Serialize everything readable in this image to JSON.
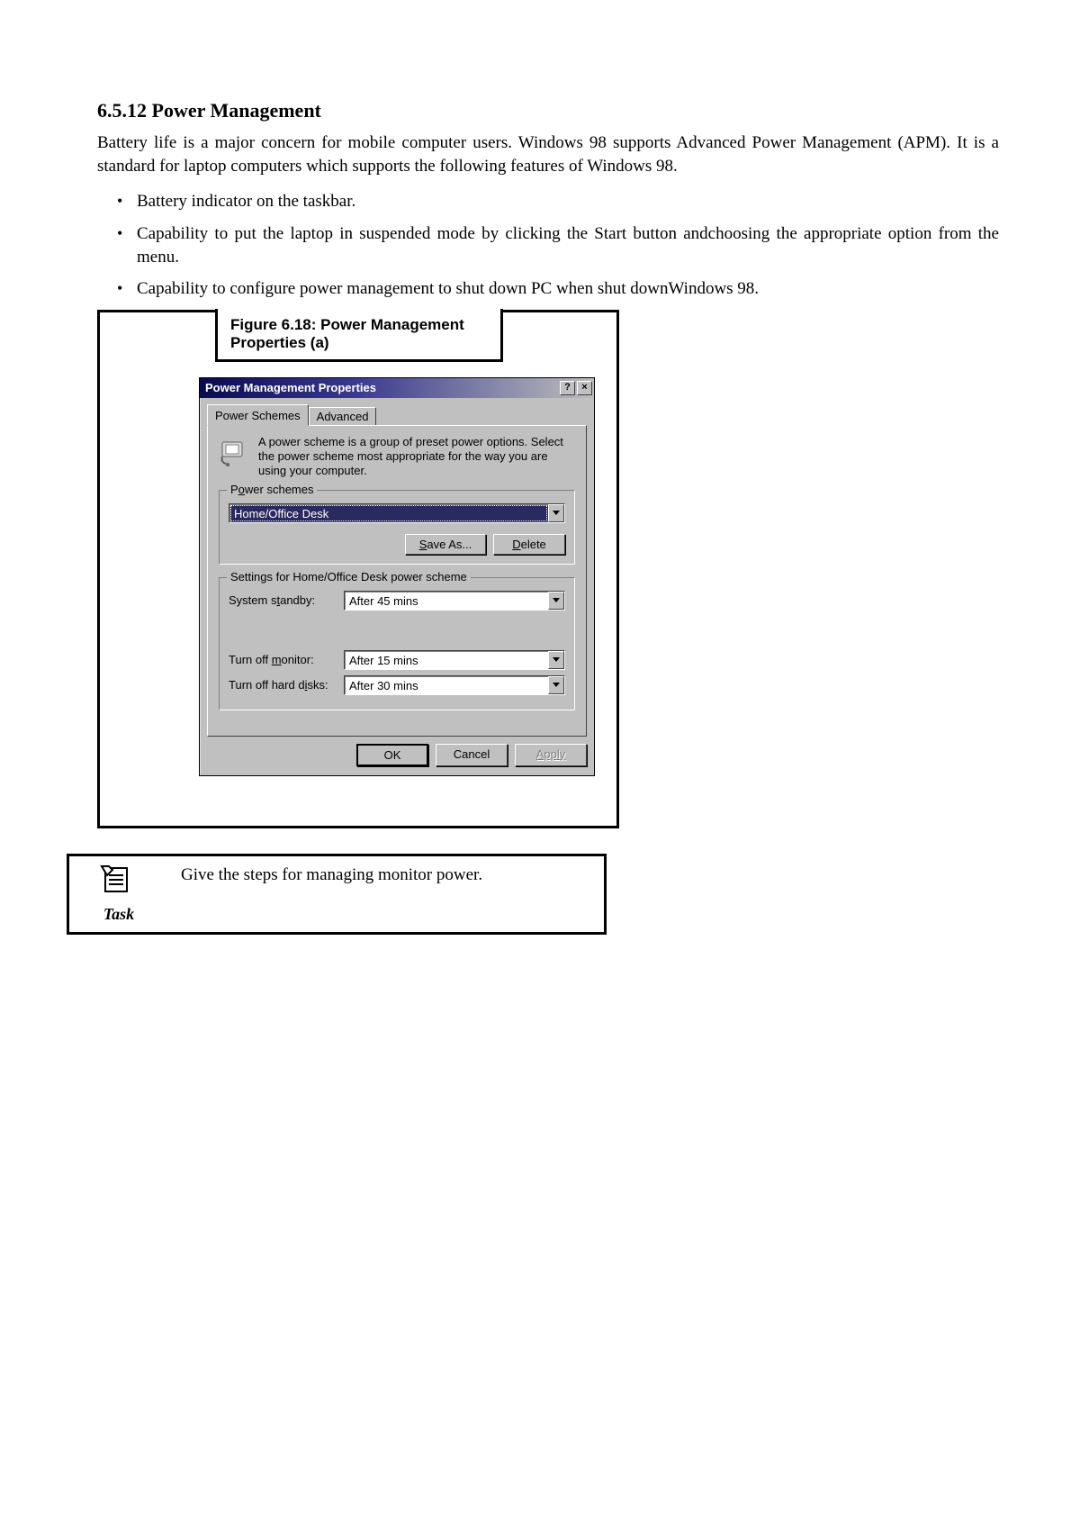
{
  "heading": "6.5.12 Power Management",
  "intro_para": "Battery life is a major concern for mobile computer users. Windows 98 supports Advanced Power Management (APM). It is a standard for laptop computers which supports the following features of Windows 98.",
  "bullets": [
    "Battery indicator on the taskbar.",
    "Capability to put the laptop in suspended mode by clicking the Start button andchoosing the appropriate option from the menu.",
    "Capability to configure power management to shut down PC when shut downWindows 98."
  ],
  "figure_caption": "Figure 6.18: Power Management Properties (a)",
  "dialog": {
    "title": "Power Management Properties",
    "help_btn": "?",
    "close_btn": "×",
    "tabs": {
      "active": "Power Schemes",
      "inactive": "Advanced"
    },
    "intro_text": "A power scheme is a group of preset power options. Select the power scheme most appropriate for the way you are using your computer.",
    "schemes": {
      "legend_pre": "P",
      "legend_ul": "o",
      "legend_post": "wer schemes",
      "selected": "Home/Office Desk",
      "save_pre": "",
      "save_ul": "S",
      "save_post": "ave As...",
      "del_pre": "",
      "del_ul": "D",
      "del_post": "elete"
    },
    "settings": {
      "legend": "Settings for Home/Office Desk power scheme",
      "standby_label_pre": "System s",
      "standby_label_ul": "t",
      "standby_label_post": "andby:",
      "standby_value": "After 45 mins",
      "monitor_label_pre": "Turn off ",
      "monitor_label_ul": "m",
      "monitor_label_post": "onitor:",
      "monitor_value": "After 15 mins",
      "disks_label_pre": "Turn off hard d",
      "disks_label_ul": "i",
      "disks_label_post": "sks:",
      "disks_value": "After 30 mins"
    },
    "buttons": {
      "ok": "OK",
      "cancel": "Cancel",
      "apply": "Apply"
    }
  },
  "task": {
    "label": "Task",
    "text": "Give the steps for managing monitor power."
  }
}
